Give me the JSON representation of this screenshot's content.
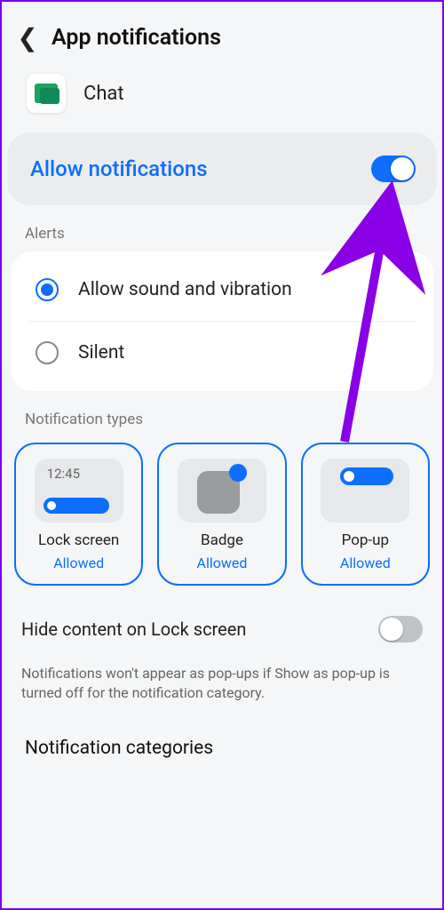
{
  "header": {
    "title": "App notifications"
  },
  "app": {
    "name": "Chat"
  },
  "allow": {
    "label": "Allow notifications",
    "enabled": true
  },
  "sections": {
    "alerts": "Alerts",
    "types": "Notification types",
    "categories": "Notification categories"
  },
  "alerts": {
    "sound": "Allow sound and vibration",
    "silent": "Silent"
  },
  "types": {
    "lock": {
      "title": "Lock screen",
      "status": "Allowed",
      "time": "12:45"
    },
    "badge": {
      "title": "Badge",
      "status": "Allowed"
    },
    "popup": {
      "title": "Pop-up",
      "status": "Allowed"
    }
  },
  "hideContent": {
    "label": "Hide content on Lock screen",
    "enabled": false
  },
  "helpText": "Notifications won't appear as pop-ups if Show as pop-up is turned off for the notification category."
}
